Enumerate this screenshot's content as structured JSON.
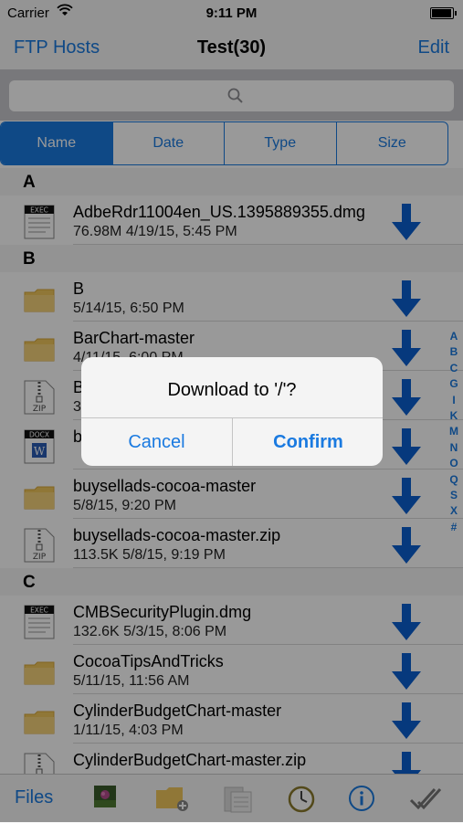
{
  "status": {
    "carrier": "Carrier",
    "time": "9:11 PM",
    "battery_level": 0.95
  },
  "nav": {
    "back_label": "FTP Hosts",
    "title": "Test(30)",
    "edit_label": "Edit"
  },
  "search": {
    "placeholder": ""
  },
  "sort": {
    "segments": [
      "Name",
      "Date",
      "Type",
      "Size"
    ],
    "active": "Name"
  },
  "sections": [
    {
      "letter": "A",
      "items": [
        {
          "name": "AdbeRdr11004en_US.1395889355.dmg",
          "meta": "76.98M 4/19/15, 5:45 PM",
          "icon": "exec-file-icon"
        }
      ]
    },
    {
      "letter": "B",
      "items": [
        {
          "name": "B",
          "meta": "5/14/15, 6:50 PM",
          "icon": "folder-icon"
        },
        {
          "name": "BarChart-master",
          "meta": "4/11/15, 6:00 PM",
          "icon": "folder-icon"
        },
        {
          "name": "B",
          "meta": "3",
          "icon": "zip-file-icon"
        },
        {
          "name": "b",
          "meta": "",
          "icon": "docx-file-icon"
        },
        {
          "name": "buysellads-cocoa-master",
          "meta": "5/8/15, 9:20 PM",
          "icon": "folder-icon"
        },
        {
          "name": "buysellads-cocoa-master.zip",
          "meta": "113.5K 5/8/15, 9:19 PM",
          "icon": "zip-file-icon"
        }
      ]
    },
    {
      "letter": "C",
      "items": [
        {
          "name": "CMBSecurityPlugin.dmg",
          "meta": "132.6K 5/3/15, 8:06 PM",
          "icon": "exec-file-icon"
        },
        {
          "name": "CocoaTipsAndTricks",
          "meta": "5/11/15, 11:56 AM",
          "icon": "folder-icon"
        },
        {
          "name": "CylinderBudgetChart-master",
          "meta": "1/11/15, 4:03 PM",
          "icon": "folder-icon"
        },
        {
          "name": "CylinderBudgetChart-master.zip",
          "meta": "",
          "icon": "zip-file-icon"
        }
      ]
    }
  ],
  "index": [
    "A",
    "B",
    "C",
    "G",
    "I",
    "K",
    "M",
    "N",
    "O",
    "Q",
    "S",
    "X",
    "#"
  ],
  "tabbar": {
    "files_label": "Files",
    "icons": [
      "photo-icon",
      "new-folder-icon",
      "paste-icon",
      "history-clock-icon",
      "info-icon",
      "select-checkmarks-icon"
    ]
  },
  "alert": {
    "message": "Download to '/'?",
    "cancel_label": "Cancel",
    "confirm_label": "Confirm"
  },
  "colors": {
    "accent": "#1a7ae0",
    "download": "#0a5fd0"
  }
}
